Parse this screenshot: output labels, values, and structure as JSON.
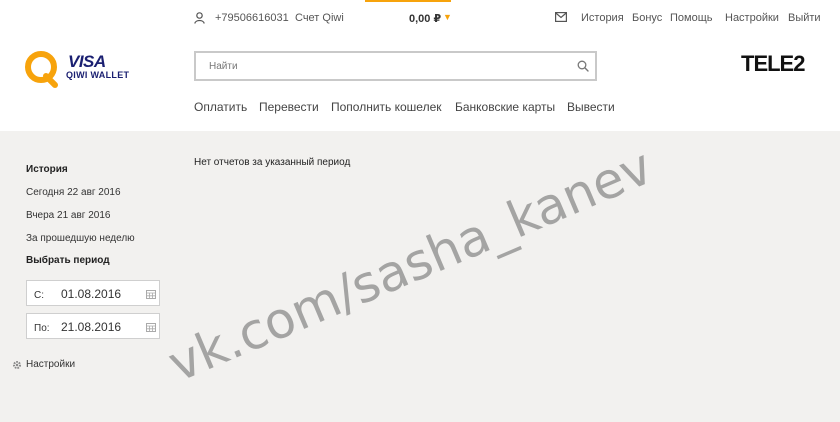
{
  "topbar": {
    "phone": "+79506616031",
    "account_label": "Счет Qiwi",
    "balance": "0,00 ₽",
    "links": [
      "История",
      "Бонус",
      "Помощь",
      "Настройки",
      "Выйти"
    ]
  },
  "logo": {
    "visa": "VISA",
    "wallet": "QIWI WALLET",
    "brand_color": "#f7a30c"
  },
  "search": {
    "placeholder": "Найти"
  },
  "partner": {
    "name": "TELE2"
  },
  "nav": [
    "Оплатить",
    "Перевести",
    "Пополнить кошелек",
    "Банковские карты",
    "Вывести"
  ],
  "sidebar": {
    "history_heading": "История",
    "items": [
      "Сегодня 22 авг 2016",
      "Вчера 21 авг 2016",
      "За прошедшую неделю"
    ],
    "period_heading": "Выбрать период",
    "from_prefix": "С:",
    "from_value": "01.08.2016",
    "to_prefix": "По:",
    "to_value": "21.08.2016",
    "settings_label": "Настройки"
  },
  "main": {
    "empty_message": "Нет отчетов за указанный период"
  },
  "watermark": "vk.com/sasha_kanev",
  "colors": {
    "accent": "#f7a30c",
    "background": "#f2f1ef"
  }
}
